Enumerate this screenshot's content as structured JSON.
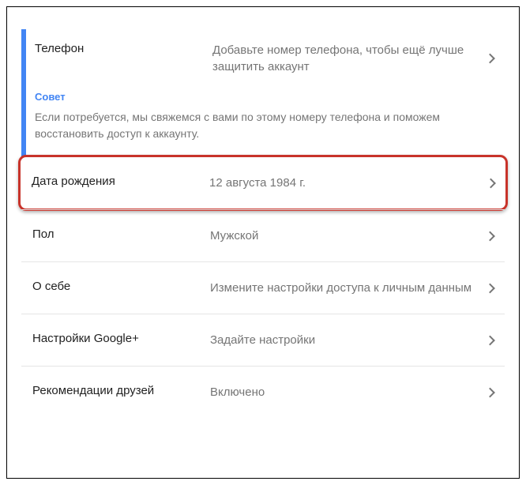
{
  "phone": {
    "label": "Телефон",
    "value": "Добавьте номер телефона, чтобы ещё лучше защитить аккаунт",
    "tip_label": "Совет",
    "tip_text": "Если потребуется, мы свяжемся с вами по этому номеру телефона и поможем восстановить доступ к аккаунту."
  },
  "birth": {
    "label": "Дата рождения",
    "value": "12 августа 1984 г."
  },
  "gender": {
    "label": "Пол",
    "value": "Мужской"
  },
  "about": {
    "label": "О себе",
    "value": "Измените настройки доступа к личным данным"
  },
  "gplus": {
    "label": "Настройки Google+",
    "value": "Задайте настройки"
  },
  "friends": {
    "label": "Рекомендации друзей",
    "value": "Включено"
  }
}
